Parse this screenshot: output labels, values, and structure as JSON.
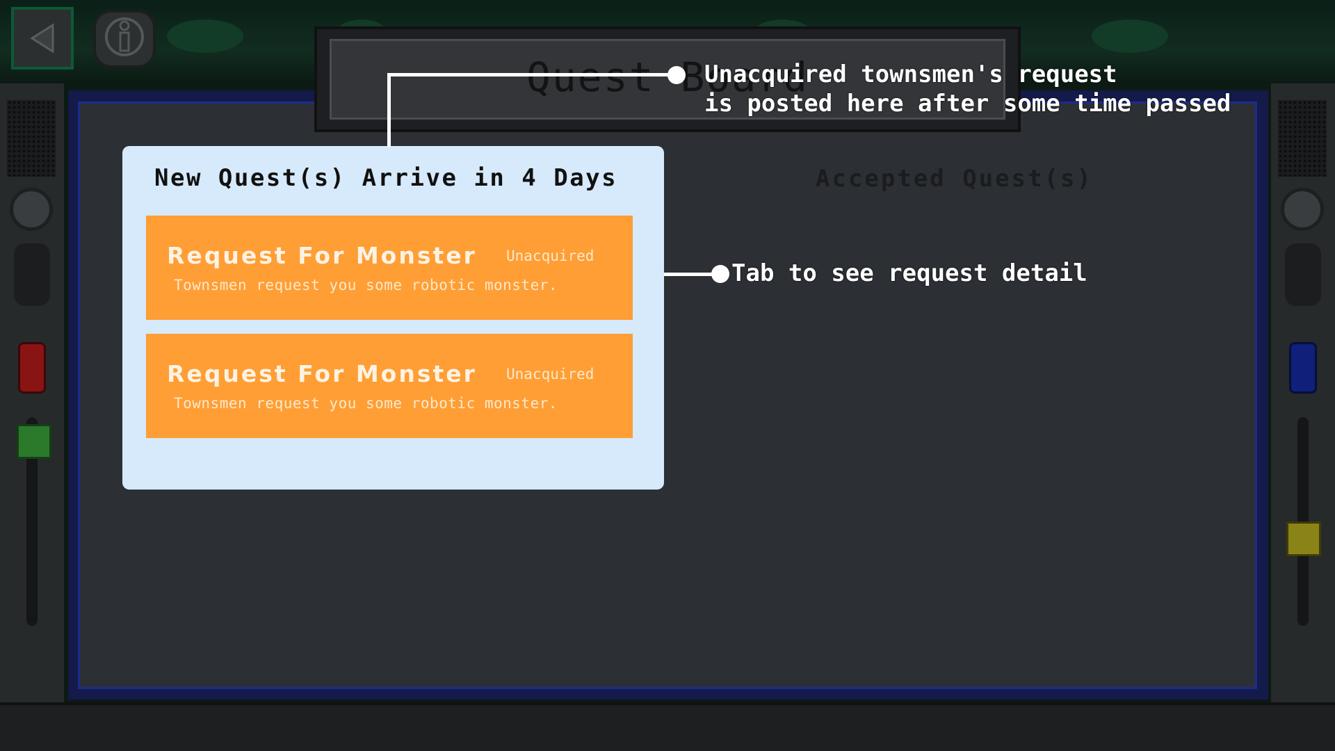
{
  "hud": {
    "back_icon": "back-triangle-icon",
    "info_icon": "info-person-icon"
  },
  "board": {
    "title": "Quest Board",
    "accepted_heading": "Accepted Quest(s)"
  },
  "new_quests": {
    "heading": "New Quest(s) Arrive in  4 Days",
    "items": [
      {
        "name": "Request For Monster",
        "status": "Unacquired",
        "description": "Townsmen request you some robotic monster."
      },
      {
        "name": "Request For Monster",
        "status": "Unacquired",
        "description": "Townsmen request you some robotic monster."
      }
    ]
  },
  "annotations": {
    "posted_note": "Unacquired townsmen's request\nis posted here after some time passed",
    "tap_note": "Tab to see request detail"
  },
  "colors": {
    "panel_bg": "#d6eafc",
    "quest_card": "#ff9e35",
    "board_bg": "#2c2f34",
    "board_border": "#1b2c8f"
  }
}
